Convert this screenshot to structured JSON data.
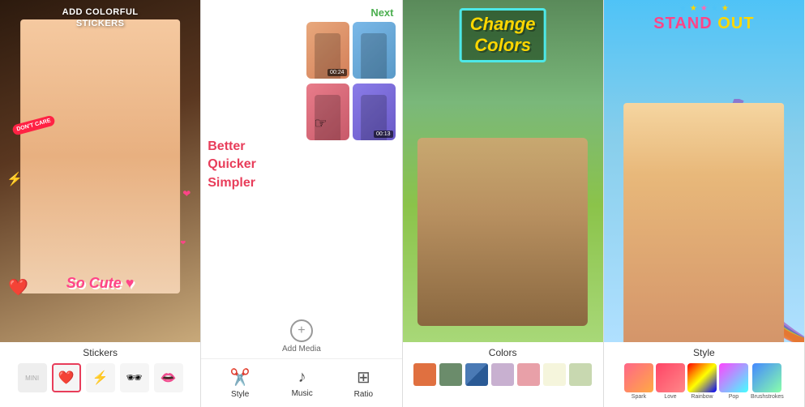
{
  "panels": {
    "stickers": {
      "title": "ADD COLORFUL\nSTICKERS",
      "label": "Stickers",
      "so_cute": "So Cute ♥",
      "dont_care": "DON'T CARE",
      "sticker_items": [
        "♥",
        "⚡",
        "🕶",
        "👄"
      ]
    },
    "edit": {
      "next_label": "Next",
      "tagline_lines": [
        "Better",
        "Quicker",
        "Simpler"
      ],
      "add_media_label": "Add Media",
      "thumb_durations": [
        "00:24",
        "00:13"
      ],
      "toolbar_items": [
        {
          "icon": "✂",
          "label": "Style"
        },
        {
          "icon": "♪",
          "label": "Music"
        },
        {
          "icon": "⊞",
          "label": "Ratio"
        }
      ]
    },
    "colors": {
      "title": "Change\nColors",
      "label": "Colors",
      "swatches": [
        {
          "color": "#e07040"
        },
        {
          "color": "#6b8c6b"
        },
        {
          "color": "#4a7ab5"
        },
        {
          "color": "#c8b0d0"
        },
        {
          "color": "#e8a0a8"
        },
        {
          "color": "#f5f5dc"
        },
        {
          "color": "#c8d8b0"
        }
      ]
    },
    "style": {
      "title": "STAND OUT",
      "label": "Style",
      "stars": [
        "★",
        "★",
        "★",
        "★",
        "★"
      ],
      "swatches": [
        {
          "label": "Spark",
          "colors": [
            "#ff6688",
            "#ffaa44"
          ]
        },
        {
          "label": "Love",
          "colors": [
            "#ff4466",
            "#ff8888"
          ]
        },
        {
          "label": "Rainbow",
          "colors": [
            "#ff0000",
            "#ffff00",
            "#0000ff"
          ]
        },
        {
          "label": "Pop",
          "colors": [
            "#ff44ff",
            "#44ffff"
          ]
        },
        {
          "label": "Brushstrokes",
          "colors": [
            "#4488ff",
            "#88ffaa"
          ]
        }
      ]
    }
  }
}
